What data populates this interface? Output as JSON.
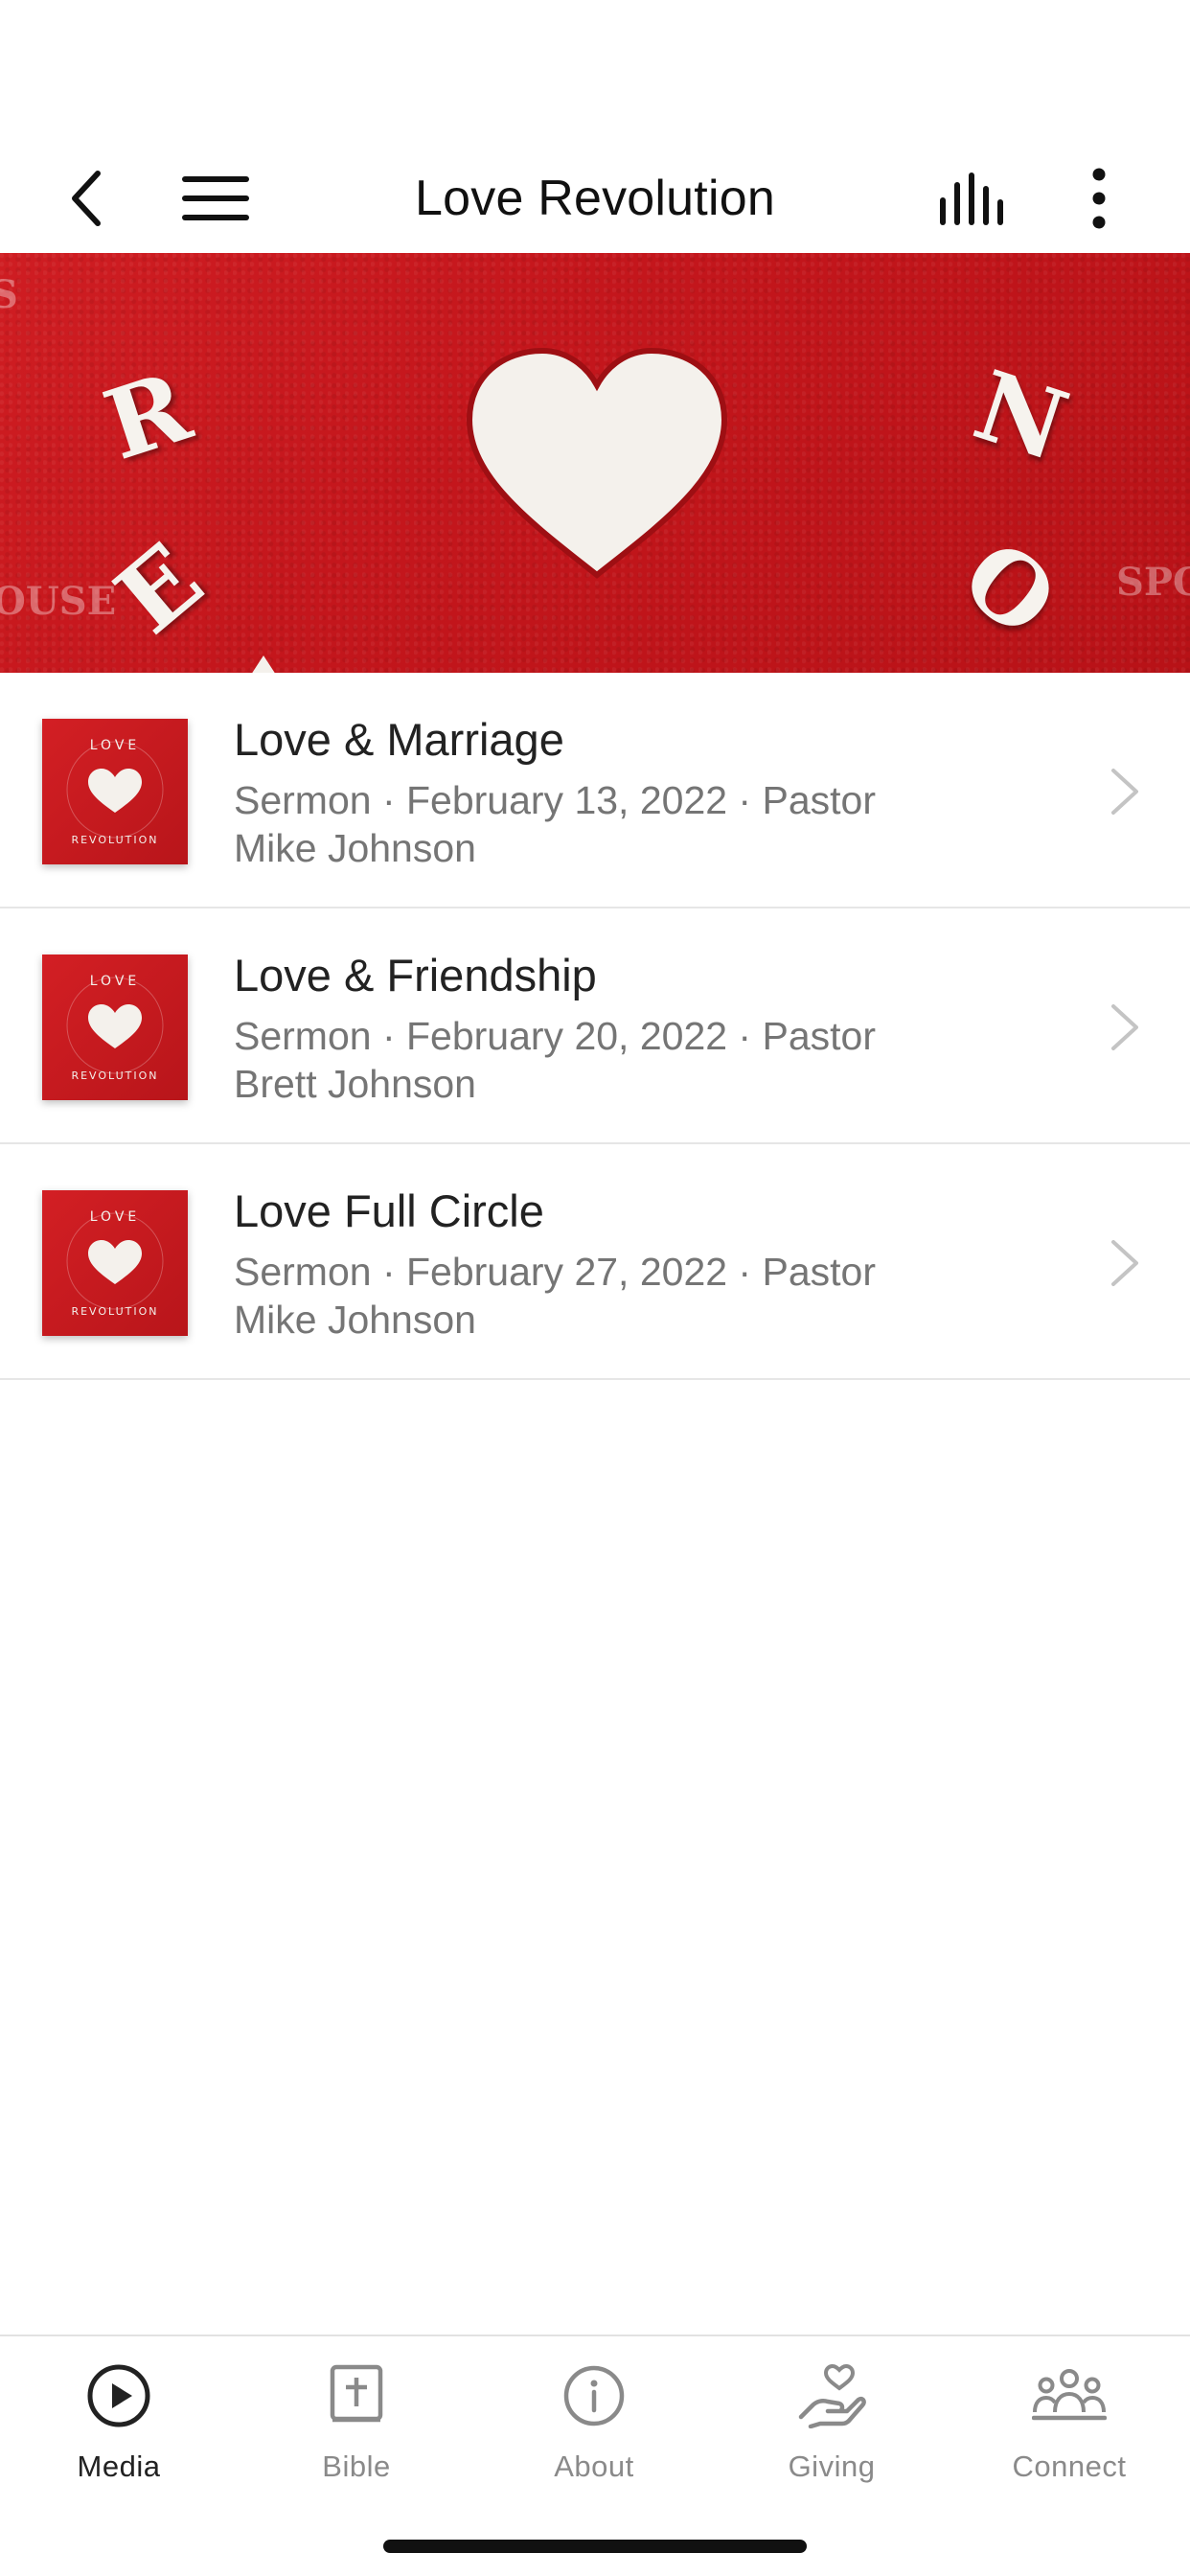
{
  "header": {
    "title": "Love Revolution"
  },
  "banner": {
    "letters": [
      "R",
      "E",
      "N",
      "O"
    ],
    "faded_left": "OUSE",
    "faded_right": "SPO",
    "faded_top": "S"
  },
  "thumbnail": {
    "top_text": "LOVE",
    "bottom_text": "REVOLUTION"
  },
  "items": [
    {
      "title": "Love & Marriage",
      "subtitle": "Sermon · February 13, 2022 · Pastor Mike Johnson"
    },
    {
      "title": "Love & Friendship",
      "subtitle": "Sermon · February 20, 2022 · Pastor Brett Johnson"
    },
    {
      "title": "Love Full Circle",
      "subtitle": "Sermon · February 27, 2022 · Pastor Mike Johnson"
    }
  ],
  "tabs": [
    {
      "label": "Media",
      "icon": "play-circle-icon",
      "active": true
    },
    {
      "label": "Bible",
      "icon": "bible-icon",
      "active": false
    },
    {
      "label": "About",
      "icon": "info-icon",
      "active": false
    },
    {
      "label": "Giving",
      "icon": "giving-hand-icon",
      "active": false
    },
    {
      "label": "Connect",
      "icon": "people-icon",
      "active": false
    }
  ],
  "colors": {
    "brand_red": "#c8181d",
    "text_primary": "#222222",
    "text_secondary": "#757575",
    "tab_inactive": "#8a8a8a",
    "divider": "#e6e6e6"
  }
}
